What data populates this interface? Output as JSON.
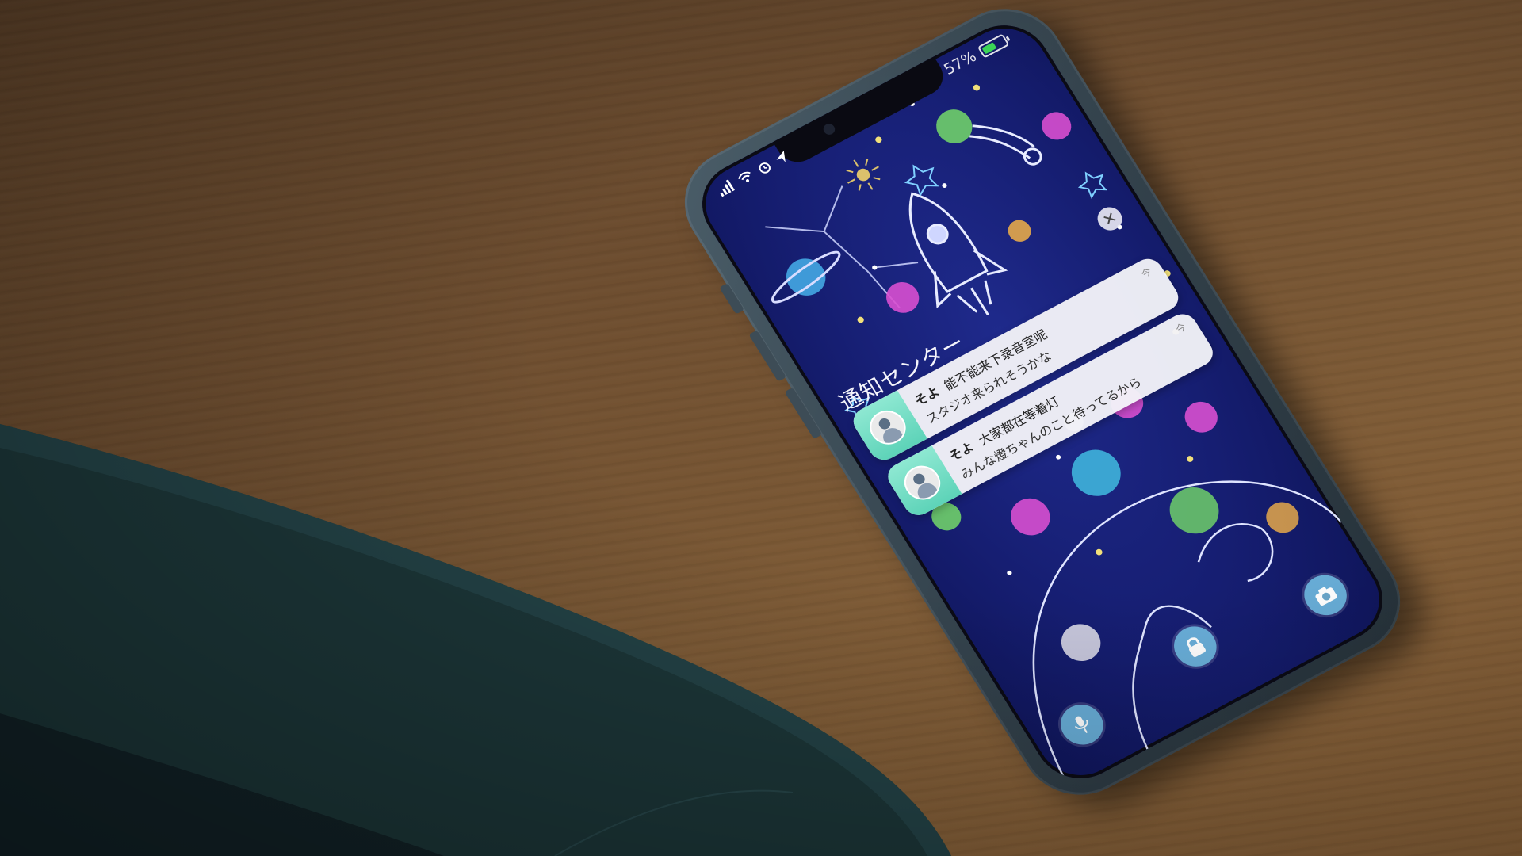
{
  "status_bar": {
    "battery_text": "57%",
    "battery_level": 0.57,
    "signal_icon": "cellular-signal-icon",
    "wifi_icon": "wifi-icon",
    "alarm_icon": "alarm-icon",
    "location_icon": "location-arrow-icon"
  },
  "notification_center": {
    "title": "通知センター",
    "close_icon": "close-icon",
    "notifications": [
      {
        "sender": "そよ",
        "text_line1": "能不能来下录音室呢",
        "text_line2": "スタジオ来られそうかな",
        "time": "今"
      },
      {
        "sender": "そよ",
        "text_line1": "大家都在等着灯",
        "text_line2": "みんな燈ちゃんのこと待ってるから",
        "time": "今"
      }
    ]
  },
  "lock_screen": {
    "lock_icon": "lock-icon",
    "microphone_icon": "microphone-icon",
    "camera_icon": "camera-icon"
  },
  "colors": {
    "wallpaper_bg": "#161e72",
    "notification_bg": "#f2f2f8",
    "app_icon_bg": "#5dd3b8",
    "battery_green": "#3ddc5a",
    "desk_wood": "#7e5b36",
    "cushion_teal": "#1d3a3c"
  }
}
